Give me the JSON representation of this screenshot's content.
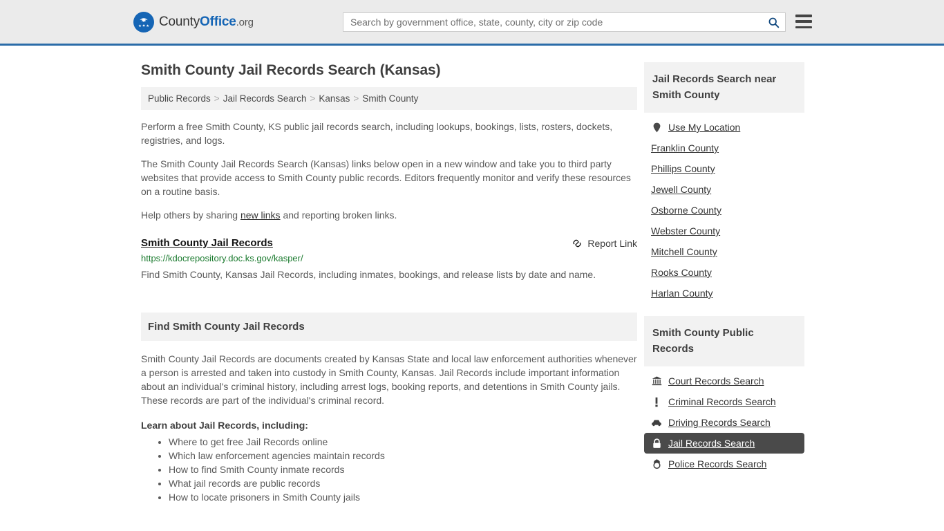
{
  "header": {
    "logo": {
      "part1": "County",
      "part2": "Office",
      "part3": ".org"
    },
    "search": {
      "value": "",
      "placeholder": "Search by government office, state, county, city or zip code",
      "button_label": "Search"
    },
    "menu_label": "Menu",
    "accent_color": "#2a6ca8",
    "background_color": "#ebebeb"
  },
  "main": {
    "page_title": "Smith County Jail Records Search (Kansas)",
    "breadcrumb": [
      {
        "label": "Public Records"
      },
      {
        "label": "Jail Records Search"
      },
      {
        "label": "Kansas"
      },
      {
        "label": "Smith County"
      }
    ],
    "breadcrumb_separator": ">",
    "intro_paragraph": "Perform a free Smith County, KS public jail records search, including lookups, bookings, lists, rosters, dockets, registries, and logs.",
    "description_paragraph": "The Smith County Jail Records Search (Kansas) links below open in a new window and take you to third party websites that provide access to Smith County public records. Editors frequently monitor and verify these resources on a routine basis.",
    "help_prefix": "Help others by sharing ",
    "help_link": "new links",
    "help_suffix": " and reporting broken links.",
    "result": {
      "title": "Smith County Jail Records",
      "url": "https://kdocrepository.doc.ks.gov/kasper/",
      "description": "Find Smith County, Kansas Jail Records, including inmates, bookings, and release lists by date and name.",
      "report_label": "Report Link",
      "report_icon": "broken-link-icon",
      "url_color": "#1a7a2e"
    },
    "section": {
      "heading": "Find Smith County Jail Records",
      "body": "Smith County Jail Records are documents created by Kansas State and local law enforcement authorities whenever a person is arrested and taken into custody in Smith County, Kansas. Jail Records include important information about an individual's criminal history, including arrest logs, booking reports, and detentions in Smith County jails. These records are part of the individual's criminal record.",
      "learn_heading": "Learn about Jail Records, including:",
      "learn_items": [
        "Where to get free Jail Records online",
        "Which law enforcement agencies maintain records",
        "How to find Smith County inmate records",
        "What jail records are public records",
        "How to locate prisoners in Smith County jails"
      ]
    }
  },
  "sidebar": {
    "nearby": {
      "title": "Jail Records Search near Smith County",
      "items": [
        {
          "label": "Use My Location",
          "icon": "map-pin-icon"
        },
        {
          "label": "Franklin County",
          "icon": ""
        },
        {
          "label": "Phillips County",
          "icon": ""
        },
        {
          "label": "Jewell County",
          "icon": ""
        },
        {
          "label": "Osborne County",
          "icon": ""
        },
        {
          "label": "Webster County",
          "icon": ""
        },
        {
          "label": "Mitchell County",
          "icon": ""
        },
        {
          "label": "Rooks County",
          "icon": ""
        },
        {
          "label": "Harlan County",
          "icon": ""
        }
      ]
    },
    "public_records": {
      "title": "Smith County Public Records",
      "active_item": "Jail Records Search",
      "active_background": "#4a4a4a",
      "items": [
        {
          "label": "Court Records Search",
          "icon": "courthouse-icon",
          "active": false
        },
        {
          "label": "Criminal Records Search",
          "icon": "exclamation-icon",
          "active": false
        },
        {
          "label": "Driving Records Search",
          "icon": "car-icon",
          "active": false
        },
        {
          "label": "Jail Records Search",
          "icon": "lock-icon",
          "active": true
        },
        {
          "label": "Police Records Search",
          "icon": "police-badge-icon",
          "active": false
        }
      ]
    }
  }
}
